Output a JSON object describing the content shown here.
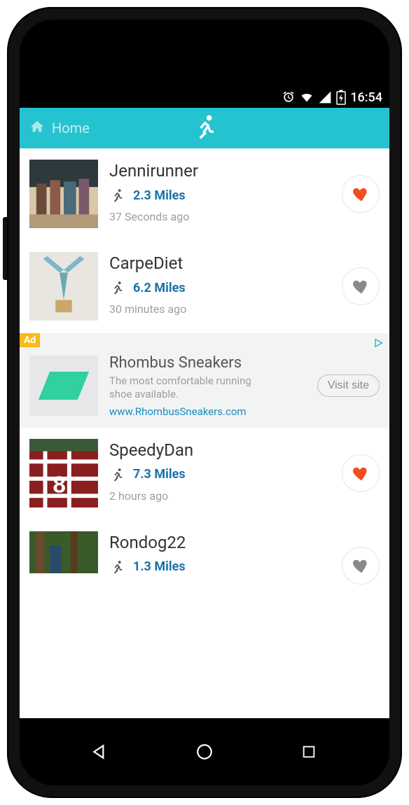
{
  "statusbar": {
    "time": "16:54"
  },
  "header": {
    "home_label": "Home"
  },
  "feed": [
    {
      "username": "Jennirunner",
      "distance": "2.3 Miles",
      "timestamp": "37 Seconds ago",
      "liked": true
    },
    {
      "username": "CarpeDiet",
      "distance": "6.2 Miles",
      "timestamp": "30 minutes ago",
      "liked": false
    },
    {
      "username": "SpeedyDan",
      "distance": "7.3 Miles",
      "timestamp": "2 hours ago",
      "liked": true
    },
    {
      "username": "Rondog22",
      "distance": "1.3 Miles",
      "timestamp": "",
      "liked": false
    }
  ],
  "ad": {
    "badge": "Ad",
    "title": "Rhombus Sneakers",
    "description": "The most comfortable running shoe available.",
    "url": "www.RhombusSneakers.com",
    "cta": "Visit site"
  },
  "colors": {
    "accent": "#25c3cf",
    "link": "#1a73a8",
    "heart_liked": "#f24d1f",
    "heart_unliked": "#8a8a8a"
  }
}
